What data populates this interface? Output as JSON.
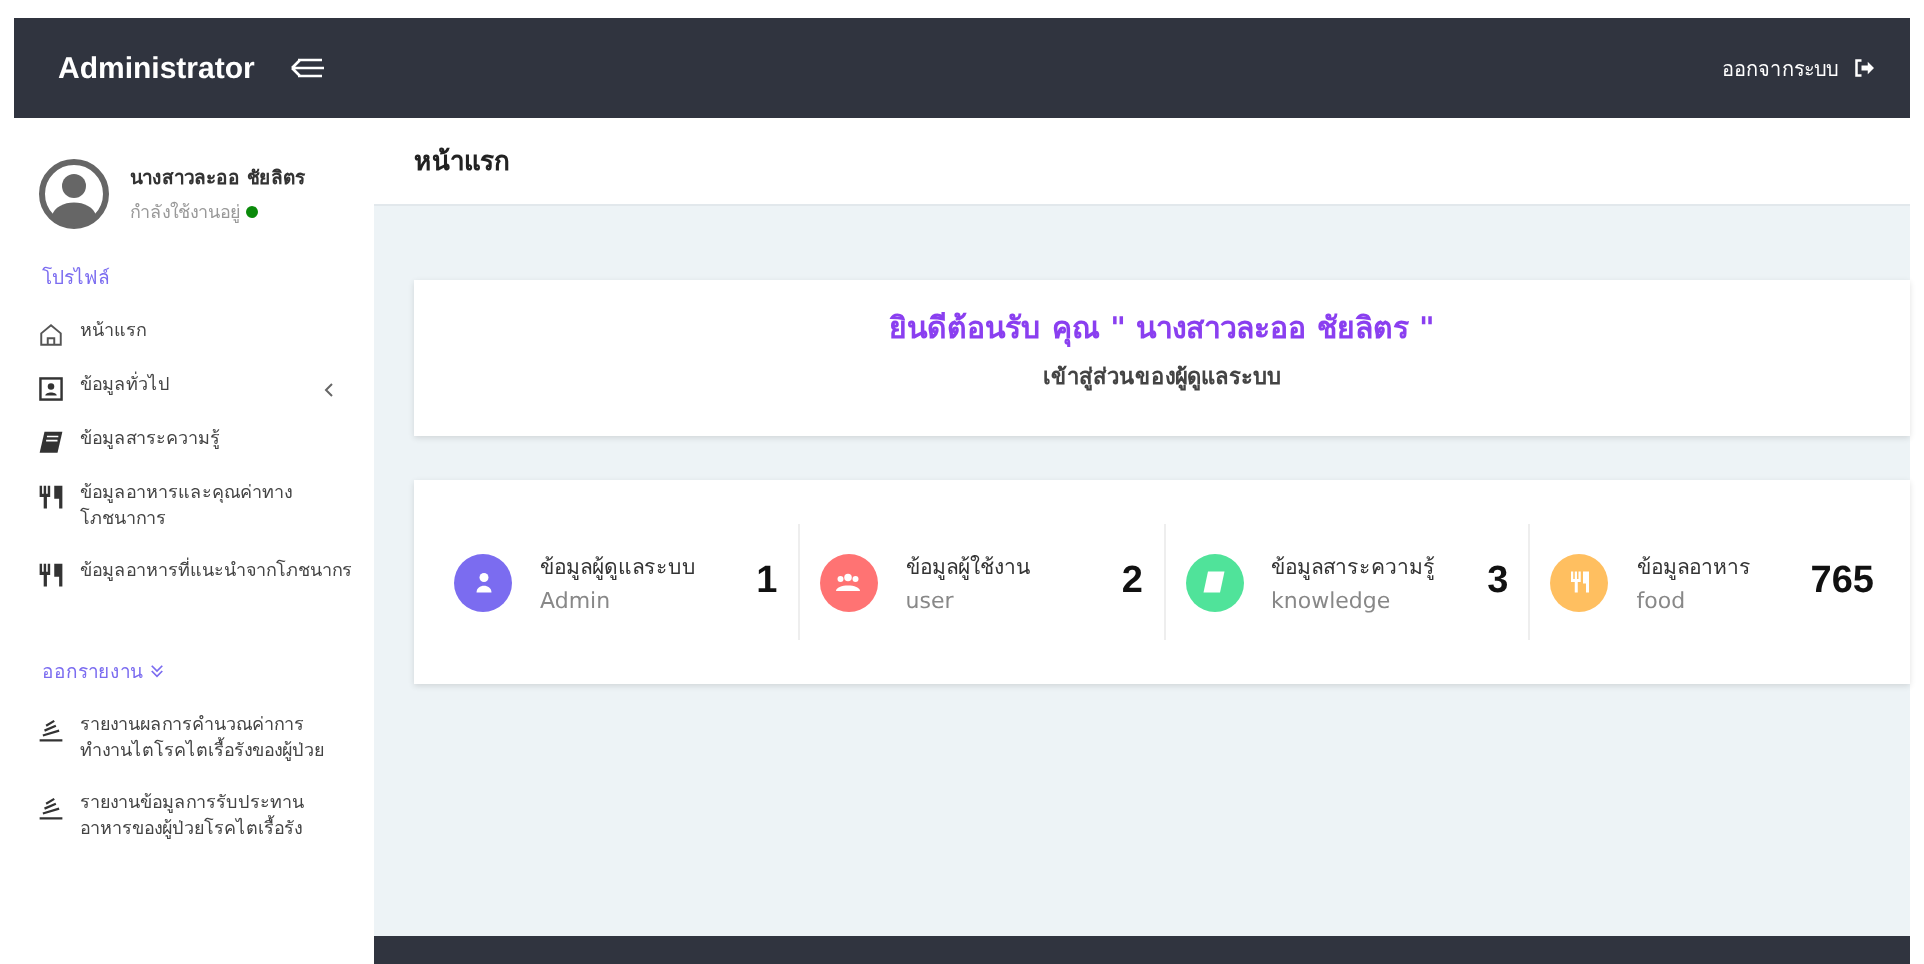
{
  "topbar": {
    "brand": "Administrator",
    "logout": "ออกจากระบบ"
  },
  "sidebar": {
    "user": {
      "name": "นางสาวละออ ชัยลิตร",
      "status": "กำลังใช้งานอยู่",
      "online": true
    },
    "sections": [
      {
        "title": "โปรไฟล์",
        "chevron": false,
        "items": [
          {
            "label": "หน้าแรก",
            "submenu": false
          },
          {
            "label": "ข้อมูลทั่วไป",
            "submenu": true
          },
          {
            "label": "ข้อมูลสาระความรู้",
            "submenu": false
          },
          {
            "label": "ข้อมูลอาหารและคุณค่าทางโภชนาการ",
            "submenu": false
          },
          {
            "label": "ข้อมูลอาหารที่แนะนำจากโภชนากร",
            "submenu": false
          }
        ]
      },
      {
        "title": "ออกรายงาน",
        "chevron": true,
        "items": [
          {
            "label": "รายงานผลการคำนวณค่าการทำงานไตโรคไตเรื้อรังของผู้ป่วย",
            "submenu": false
          },
          {
            "label": "รายงานข้อมูลการรับประทานอาหารของผู้ป่วยโรคไตเรื้อรัง",
            "submenu": false
          }
        ]
      }
    ]
  },
  "page_title": "หน้าแรก",
  "welcome": {
    "title": "ยินดีต้อนรับ คุณ \" นางสาวละออ ชัยลิตร \"",
    "subtitle": "เข้าสู่ส่วนของผู้ดูแลระบบ"
  },
  "stats": [
    {
      "label": "ข้อมูลผู้ดูแลระบบ",
      "sub": "Admin",
      "count": "1",
      "color": "#7b6cf0"
    },
    {
      "label": "ข้อมูลผู้ใช้งาน",
      "sub": "user",
      "count": "2",
      "color": "#ff7373"
    },
    {
      "label": "ข้อมูลสาระความรู้",
      "sub": "knowledge",
      "count": "3",
      "color": "#50e39a"
    },
    {
      "label": "ข้อมูลอาหาร",
      "sub": "food",
      "count": "765",
      "color": "#ffbf60"
    }
  ]
}
